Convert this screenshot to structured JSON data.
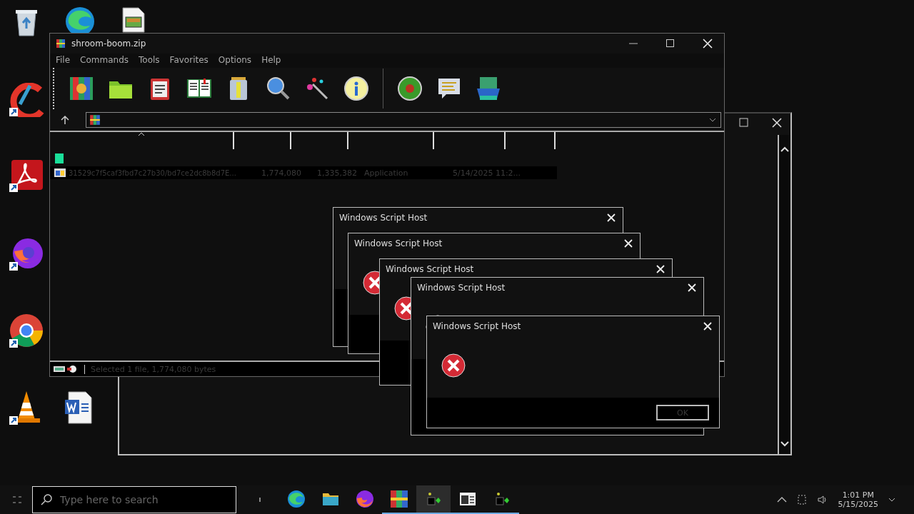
{
  "window": {
    "title": "shroom-boom.zip",
    "menu": [
      "File",
      "Commands",
      "Tools",
      "Favorites",
      "Options",
      "Help"
    ]
  },
  "file_list": {
    "rows": [
      {
        "kind": "folder",
        "selected": false
      },
      {
        "kind": "file",
        "selected": true,
        "name": "31529c7f5caf3fbd7c27b30/bd7ce2dc8b8d7E...",
        "size": "1,774,080",
        "packed": "1,335,382",
        "type": "Application",
        "modified": "5/14/2025 11:2..."
      }
    ]
  },
  "status_bar": {
    "text": "Selected 1 file, 1,774,080 bytes"
  },
  "dialogs": [
    {
      "kind": "covered",
      "title": "Windows Script Host"
    },
    {
      "kind": "error",
      "title": "Windows Script Host"
    },
    {
      "kind": "error",
      "title": "Windows Script Host"
    },
    {
      "kind": "error",
      "title": "Windows Script Host"
    },
    {
      "kind": "error",
      "title": "Windows Script Host",
      "button": "OK"
    }
  ],
  "taskbar": {
    "search": {
      "placeholder": "Type here to search"
    },
    "apps": [
      {
        "kind": "edge",
        "running": false,
        "selected": false
      },
      {
        "kind": "folder",
        "running": false,
        "selected": false
      },
      {
        "kind": "firefox",
        "running": false,
        "selected": false
      },
      {
        "kind": "archive",
        "running": true,
        "selected": false
      },
      {
        "kind": "script",
        "running": true,
        "selected": true
      },
      {
        "kind": "window",
        "running": true,
        "selected": false
      },
      {
        "kind": "script",
        "running": true,
        "selected": false
      }
    ],
    "time": "1:01 PM",
    "date": "5/15/2025"
  }
}
